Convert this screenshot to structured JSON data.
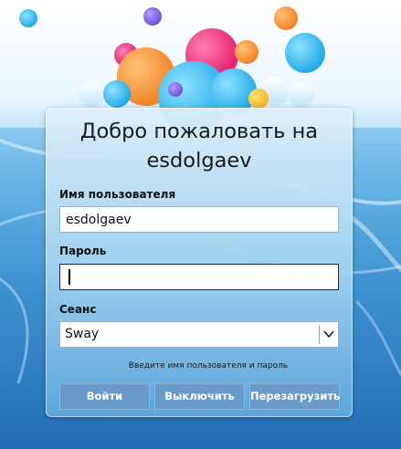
{
  "greeter": {
    "welcome_text": "Добро пожаловать на esdolgaev",
    "username_label": "Имя пользователя",
    "username_value": "esdolgaev",
    "password_label": "Пароль",
    "password_value": "",
    "session_label": "Сеанс",
    "session_value": "Sway",
    "hint_text": "Введите имя пользователя и пароль",
    "buttons": {
      "login": "Войти",
      "shutdown": "Выключить",
      "reboot": "Перезагрузить"
    }
  },
  "colors": {
    "button_bg": "#6a9ac8",
    "panel_top": "#e1f0fa",
    "panel_bottom": "#5faade"
  },
  "icons": {
    "dropdown": "chevron-down-icon"
  }
}
